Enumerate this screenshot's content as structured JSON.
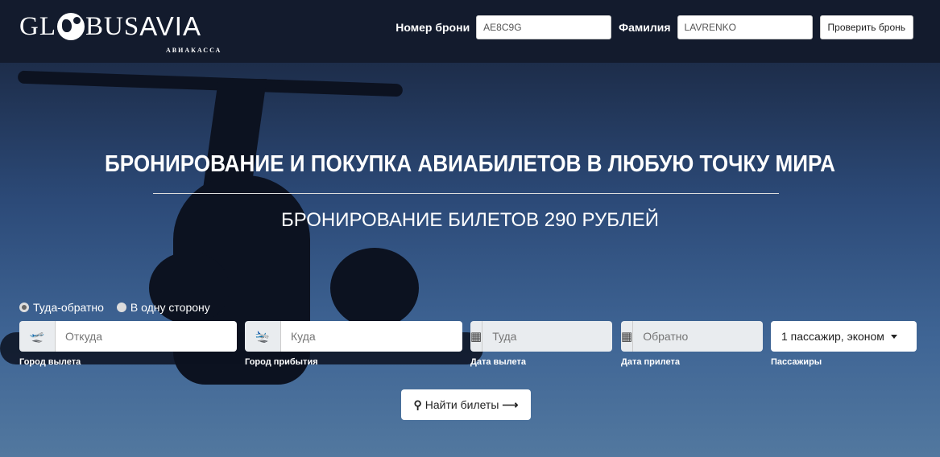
{
  "header": {
    "logo_left": "GL",
    "logo_mid": "BUS",
    "logo_right": "AVIA",
    "logo_sub": "АВИАКАССА",
    "booking_label": "Номер брони",
    "booking_value": "AE8C9G",
    "surname_label": "Фамилия",
    "surname_value": "LAVRENKO",
    "check_button": "Проверить бронь"
  },
  "hero": {
    "title": "БРОНИРОВАНИЕ И ПОКУПКА АВИАБИЛЕТОВ В ЛЮБУЮ ТОЧКУ МИРА",
    "subtitle": "БРОНИРОВАНИЕ БИЛЕТОВ 290 РУБЛЕЙ"
  },
  "search": {
    "trip_types": [
      {
        "label": "Туда-обратно",
        "selected": true
      },
      {
        "label": "В одну сторону",
        "selected": false
      }
    ],
    "from": {
      "placeholder": "Откуда",
      "label": "Город вылета",
      "icon": "plane-departure-icon"
    },
    "to": {
      "placeholder": "Куда",
      "label": "Город прибытия",
      "icon": "plane-arrival-icon"
    },
    "depart": {
      "placeholder": "Туда",
      "label": "Дата вылета",
      "icon": "calendar-icon"
    },
    "return": {
      "placeholder": "Обратно",
      "label": "Дата прилета",
      "icon": "calendar-icon"
    },
    "passengers": {
      "value": "1 пассажир, эконом",
      "label": "Пассажиры"
    },
    "find_button": "Найти билеты"
  }
}
